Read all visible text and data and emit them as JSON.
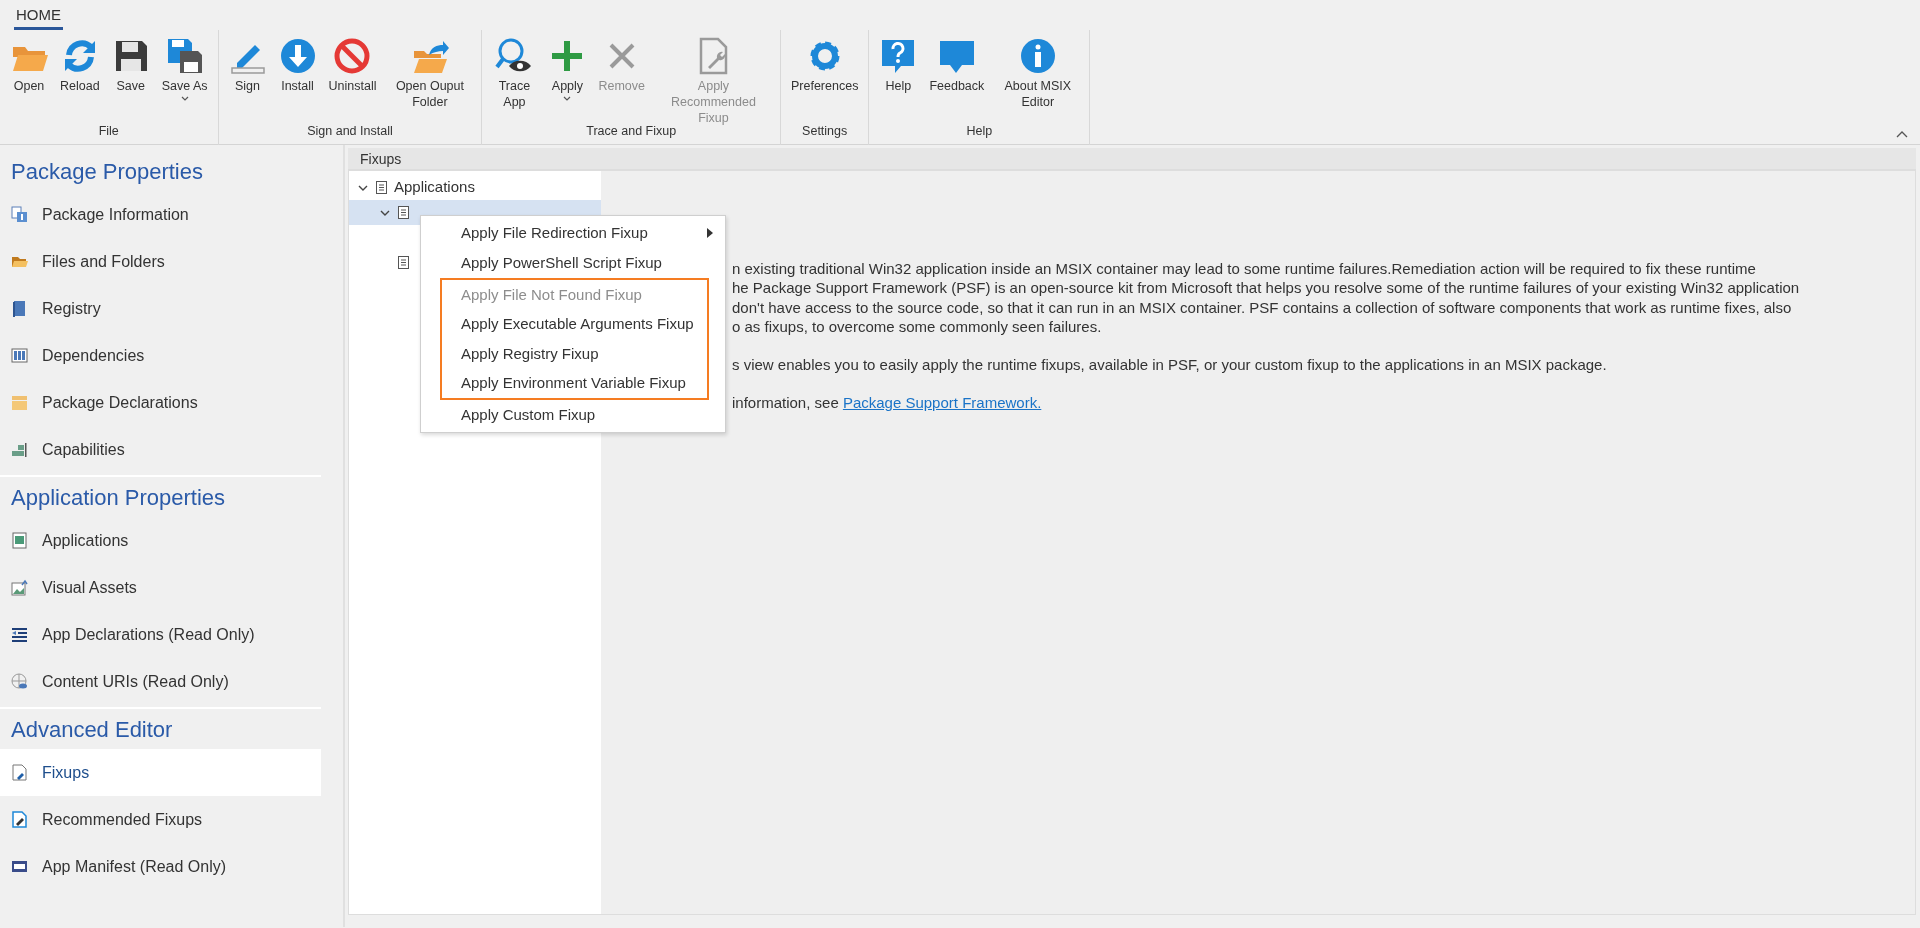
{
  "ribbon": {
    "tabs": [
      {
        "label": "HOME",
        "selected": true
      }
    ],
    "groups": [
      {
        "label": "File",
        "buttons": [
          {
            "label": "Open",
            "disabled": false,
            "dropdown": false
          },
          {
            "label": "Reload",
            "disabled": false,
            "dropdown": false
          },
          {
            "label": "Save",
            "disabled": false,
            "dropdown": false
          },
          {
            "label": "Save As",
            "disabled": false,
            "dropdown": true
          }
        ]
      },
      {
        "label": "Sign and Install",
        "buttons": [
          {
            "label": "Sign",
            "disabled": false,
            "dropdown": false
          },
          {
            "label": "Install",
            "disabled": false,
            "dropdown": false
          },
          {
            "label": "Uninstall",
            "disabled": false,
            "dropdown": false
          },
          {
            "label": "Open Ouput Folder",
            "disabled": false,
            "dropdown": false
          }
        ]
      },
      {
        "label": "Trace and Fixup",
        "buttons": [
          {
            "label": "Trace App",
            "disabled": false,
            "dropdown": false
          },
          {
            "label": "Apply",
            "disabled": false,
            "dropdown": true
          },
          {
            "label": "Remove",
            "disabled": true,
            "dropdown": false
          },
          {
            "label": "Apply Recommended Fixup",
            "disabled": true,
            "dropdown": false
          }
        ]
      },
      {
        "label": "Settings",
        "buttons": [
          {
            "label": "Preferences",
            "disabled": false,
            "dropdown": false
          }
        ]
      },
      {
        "label": "Help",
        "buttons": [
          {
            "label": "Help",
            "disabled": false,
            "dropdown": false
          },
          {
            "label": "Feedback",
            "disabled": false,
            "dropdown": false
          },
          {
            "label": "About MSIX Editor",
            "disabled": false,
            "dropdown": false
          }
        ]
      }
    ]
  },
  "sidebar": {
    "sections": [
      {
        "title": "Package Properties",
        "items": [
          {
            "label": "Package Information",
            "selected": false
          },
          {
            "label": "Files and Folders",
            "selected": false
          },
          {
            "label": "Registry",
            "selected": false
          },
          {
            "label": "Dependencies",
            "selected": false
          },
          {
            "label": "Package Declarations",
            "selected": false
          },
          {
            "label": "Capabilities",
            "selected": false
          }
        ]
      },
      {
        "title": "Application Properties",
        "items": [
          {
            "label": "Applications",
            "selected": false
          },
          {
            "label": "Visual Assets",
            "selected": false
          },
          {
            "label": "App Declarations (Read Only)",
            "selected": false
          },
          {
            "label": "Content URIs (Read Only)",
            "selected": false
          }
        ]
      },
      {
        "title": "Advanced Editor",
        "items": [
          {
            "label": "Fixups",
            "selected": true
          },
          {
            "label": "Recommended Fixups",
            "selected": false
          },
          {
            "label": "App Manifest (Read Only)",
            "selected": false
          }
        ]
      }
    ]
  },
  "panel": {
    "title": "Fixups",
    "tree": [
      {
        "label": "Applications",
        "expanded": true,
        "selected": false,
        "children": [
          {
            "expanded": true,
            "selected": true
          },
          {
            "selected": false
          }
        ]
      }
    ],
    "description": {
      "lines": [
        "n existing traditional Win32 application inside an MSIX container may lead to some runtime failures.Remediation action will be required to fix these runtime",
        "he Package Support Framework (PSF) is an open-source kit from Microsoft that helps you resolve some of the runtime failures of your existing Win32 application",
        "don't have access to the source code, so that it can run in an MSIX container. PSF contains a collection of software components that work as runtime fixes, also",
        "o as fixups, to overcome some commonly seen failures."
      ],
      "paragraph_2": "s view enables you to easily apply the runtime fixups, available in PSF, or your custom fixup to the applications in an MSIX package.",
      "link_prefix": "information, see ",
      "link": "Package Support Framework."
    }
  },
  "context_menu": {
    "items": [
      {
        "label": "Apply File Redirection Fixup",
        "disabled": false,
        "submenu": true,
        "outlined": false
      },
      {
        "label": "Apply PowerShell Script Fixup",
        "disabled": false,
        "submenu": false,
        "outlined": false
      },
      {
        "label": "Apply File Not Found Fixup",
        "disabled": true,
        "submenu": false,
        "outlined": true
      },
      {
        "label": "Apply Executable Arguments Fixup",
        "disabled": false,
        "submenu": false,
        "outlined": true
      },
      {
        "label": "Apply Registry Fixup",
        "disabled": false,
        "submenu": false,
        "outlined": true
      },
      {
        "label": "Apply Environment Variable Fixup",
        "disabled": false,
        "submenu": false,
        "outlined": true
      },
      {
        "label": "Apply Custom Fixup",
        "disabled": false,
        "submenu": false,
        "outlined": false
      }
    ]
  }
}
